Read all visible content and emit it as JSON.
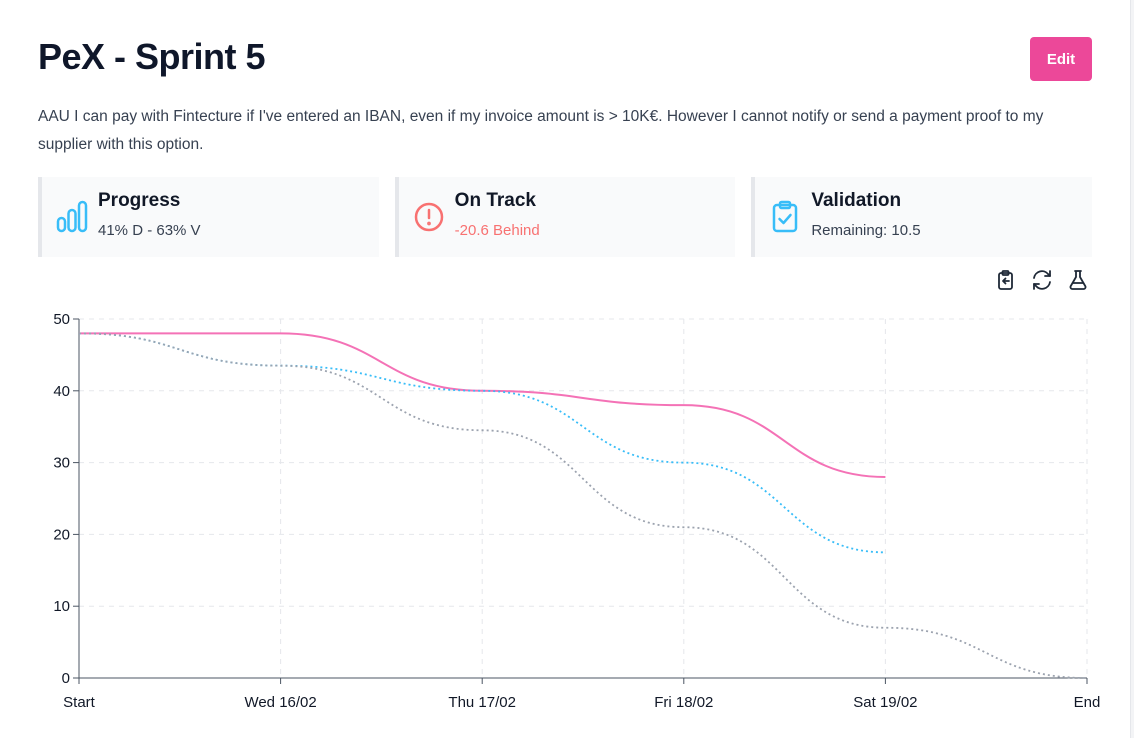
{
  "header": {
    "title": "PeX - Sprint 5",
    "edit_label": "Edit"
  },
  "description": "AAU I can pay with Fintecture if I've entered an IBAN, even if my invoice amount is > 10K€. However I cannot notify or send a payment proof to my supplier with this option.",
  "cards": [
    {
      "title": "Progress",
      "subtitle": "41% D - 63% V",
      "icon": "bar-chart-icon"
    },
    {
      "title": "On Track",
      "subtitle": "-20.6 Behind",
      "icon": "alert-circle-icon",
      "subtitle_color": "#f87171"
    },
    {
      "title": "Validation",
      "subtitle": "Remaining: 10.5",
      "icon": "clipboard-check-icon"
    }
  ],
  "toolbar": {
    "icons": [
      "clipboard-export-icon",
      "refresh-icon",
      "flask-icon"
    ],
    "active": "flask-icon"
  },
  "colors": {
    "accent": "#ec4899",
    "icon_blue": "#38bdf8",
    "alert_red": "#f87171"
  },
  "chart_data": {
    "type": "line",
    "categories": [
      "Start",
      "Wed 16/02",
      "Thu 17/02",
      "Fri 18/02",
      "Sat 19/02",
      "End"
    ],
    "ylim": [
      0,
      50
    ],
    "yticks": [
      0,
      10,
      20,
      30,
      40,
      50
    ],
    "grid": true,
    "series": [
      {
        "values": [
          48,
          48,
          40,
          38,
          28,
          null
        ],
        "color": "#f472b6",
        "style": "solid"
      },
      {
        "values": [
          48,
          43.5,
          40,
          30,
          17.5,
          null
        ],
        "color": "#38bdf8",
        "style": "dotted"
      },
      {
        "values": [
          48,
          43.5,
          34.5,
          21,
          7,
          0
        ],
        "color": "#9ca3af",
        "style": "dotted"
      }
    ]
  }
}
